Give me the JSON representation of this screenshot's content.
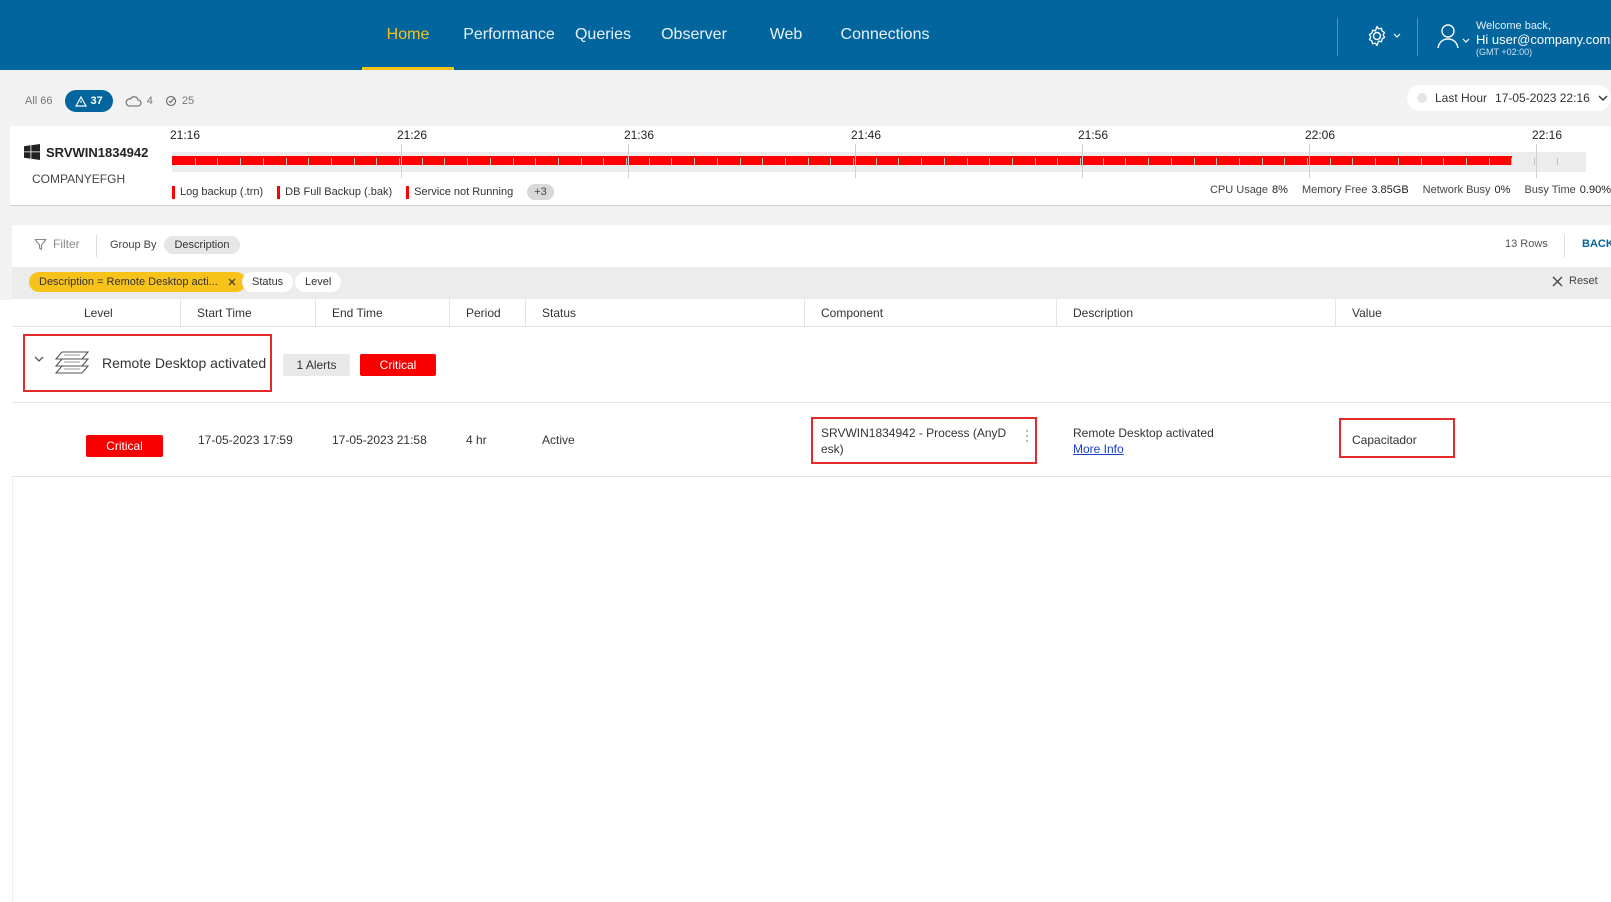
{
  "nav": {
    "items": [
      {
        "label": "Home",
        "active": true
      },
      {
        "label": "Performance",
        "active": false
      },
      {
        "label": "Queries",
        "active": false
      },
      {
        "label": "Observer",
        "active": false
      },
      {
        "label": "Web",
        "active": false
      },
      {
        "label": "Connections",
        "active": false
      }
    ]
  },
  "user": {
    "welcome": "Welcome back,",
    "greeting": "Hi user@company.com",
    "timezone": "(GMT +02:00)"
  },
  "counters": {
    "all": "All 66",
    "warnings": "37",
    "cloud": "4",
    "checked": "25"
  },
  "range": {
    "label": "Last Hour",
    "datetime": "17-05-2023 22:16"
  },
  "timeline": {
    "host": "SRVWIN1834942",
    "company": "COMPANYEFGH",
    "ticks": [
      "21:16",
      "21:26",
      "21:36",
      "21:46",
      "21:56",
      "22:06",
      "22:16"
    ],
    "fill_fraction": 0.948,
    "legend": [
      "Log backup (.trn)",
      "DB Full Backup (.bak)",
      "Service not Running"
    ],
    "more": "+3",
    "metrics": [
      {
        "label": "CPU Usage",
        "value": "8%"
      },
      {
        "label": "Memory Free",
        "value": "3.85GB"
      },
      {
        "label": "Network Busy",
        "value": "0%"
      },
      {
        "label": "Busy Time",
        "value": "0.90%"
      }
    ]
  },
  "toolbar": {
    "filter": "Filter",
    "group_by": "Group By",
    "group_value": "Description",
    "rows": "13 Rows",
    "back": "BACK"
  },
  "chips": {
    "description": "Description = Remote Desktop acti...",
    "status": "Status",
    "level": "Level",
    "reset": "Reset"
  },
  "table": {
    "headers": [
      "Level",
      "Start Time",
      "End Time",
      "Period",
      "Status",
      "Component",
      "Description",
      "Value"
    ],
    "group": {
      "title": "Remote Desktop activated",
      "alerts": "1 Alerts",
      "level": "Critical"
    },
    "rows": [
      {
        "level": "Critical",
        "start": "17-05-2023 17:59",
        "end": "17-05-2023 21:58",
        "period": "4 hr",
        "status": "Active",
        "component_l1": "SRVWIN1834942 - Process (AnyD",
        "component_l2": "esk)",
        "description": "Remote Desktop activated",
        "more_info": "More Info",
        "value": "Capacitador"
      }
    ]
  },
  "colors": {
    "brand": "#03659e",
    "accent": "#f7c21a",
    "critical": "#f60000"
  }
}
